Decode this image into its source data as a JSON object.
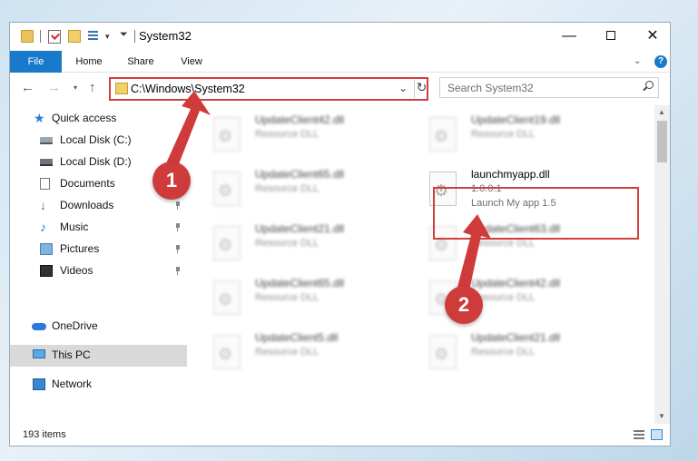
{
  "window": {
    "title": "System32",
    "minimize_glyph": "—",
    "close_glyph": "✕"
  },
  "ribbon": {
    "tabs": [
      "File",
      "Home",
      "Share",
      "View"
    ],
    "expand_glyph": "⌄",
    "help_glyph": "?"
  },
  "nav": {
    "back_glyph": "←",
    "forward_glyph": "→",
    "recent_glyph": "▾",
    "up_glyph": "↑",
    "address": "C:\\Windows\\System32",
    "address_dropdown_glyph": "⌄",
    "refresh_glyph": "↻",
    "search_placeholder": "Search System32"
  },
  "sidebar": {
    "items": [
      {
        "label": "Quick access",
        "icon": "star-icon",
        "pinned": false
      },
      {
        "label": "Local Disk (C:)",
        "icon": "drive-icon",
        "pinned": false
      },
      {
        "label": "Local Disk (D:)",
        "icon": "drive-icon",
        "pinned": false
      },
      {
        "label": "Documents",
        "icon": "documents-icon",
        "pinned": true
      },
      {
        "label": "Downloads",
        "icon": "download-icon",
        "pinned": true
      },
      {
        "label": "Music",
        "icon": "music-icon",
        "pinned": true
      },
      {
        "label": "Pictures",
        "icon": "pictures-icon",
        "pinned": true
      },
      {
        "label": "Videos",
        "icon": "videos-icon",
        "pinned": true
      },
      {
        "label": "OneDrive",
        "icon": "cloud-icon",
        "pinned": false
      },
      {
        "label": "This PC",
        "icon": "computer-icon",
        "pinned": false,
        "selected": true
      },
      {
        "label": "Network",
        "icon": "network-icon",
        "pinned": false
      }
    ]
  },
  "files": [
    {
      "name": "UpdateClient42.dll",
      "type": "Resource DLL"
    },
    {
      "name": "UpdateClient19.dll",
      "type": "Resource DLL"
    },
    {
      "name": "UpdateClient65.dll",
      "type": "Resource DLL"
    },
    {
      "name": "launchmyapp.dll",
      "version": "1.0.0.1",
      "description": "Launch My app 1.5",
      "highlighted": true
    },
    {
      "name": "UpdateClient21.dll",
      "type": "Resource DLL"
    },
    {
      "name": "UpdateClient63.dll",
      "type": "Resource DLL"
    },
    {
      "name": "UpdateClient65.dll",
      "type": "Resource DLL"
    },
    {
      "name": "UpdateClient42.dll",
      "type": "Resource DLL"
    },
    {
      "name": "UpdateClient5.dll",
      "type": "Resource DLL"
    },
    {
      "name": "UpdateClient21.dll",
      "type": "Resource DLL"
    }
  ],
  "status": {
    "item_count": "193 items"
  },
  "annotations": {
    "step1": "1",
    "step2": "2",
    "color": "#cf3b3b"
  },
  "scrollbar": {
    "up_glyph": "▲",
    "down_glyph": "▼"
  }
}
